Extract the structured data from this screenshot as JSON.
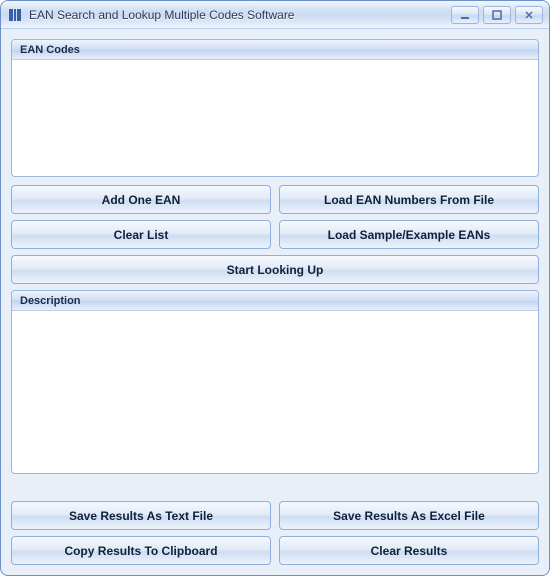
{
  "window": {
    "title": "EAN Search and Lookup Multiple Codes Software"
  },
  "panels": {
    "codes": {
      "header": "EAN Codes"
    },
    "description": {
      "header": "Description"
    }
  },
  "buttons": {
    "add_one_ean": "Add One EAN",
    "load_from_file": "Load EAN Numbers From File",
    "clear_list": "Clear List",
    "load_sample": "Load Sample/Example EANs",
    "start_lookup": "Start Looking Up",
    "save_text": "Save Results As Text File",
    "save_excel": "Save Results As Excel File",
    "copy_clipboard": "Copy Results To Clipboard",
    "clear_results": "Clear Results"
  }
}
